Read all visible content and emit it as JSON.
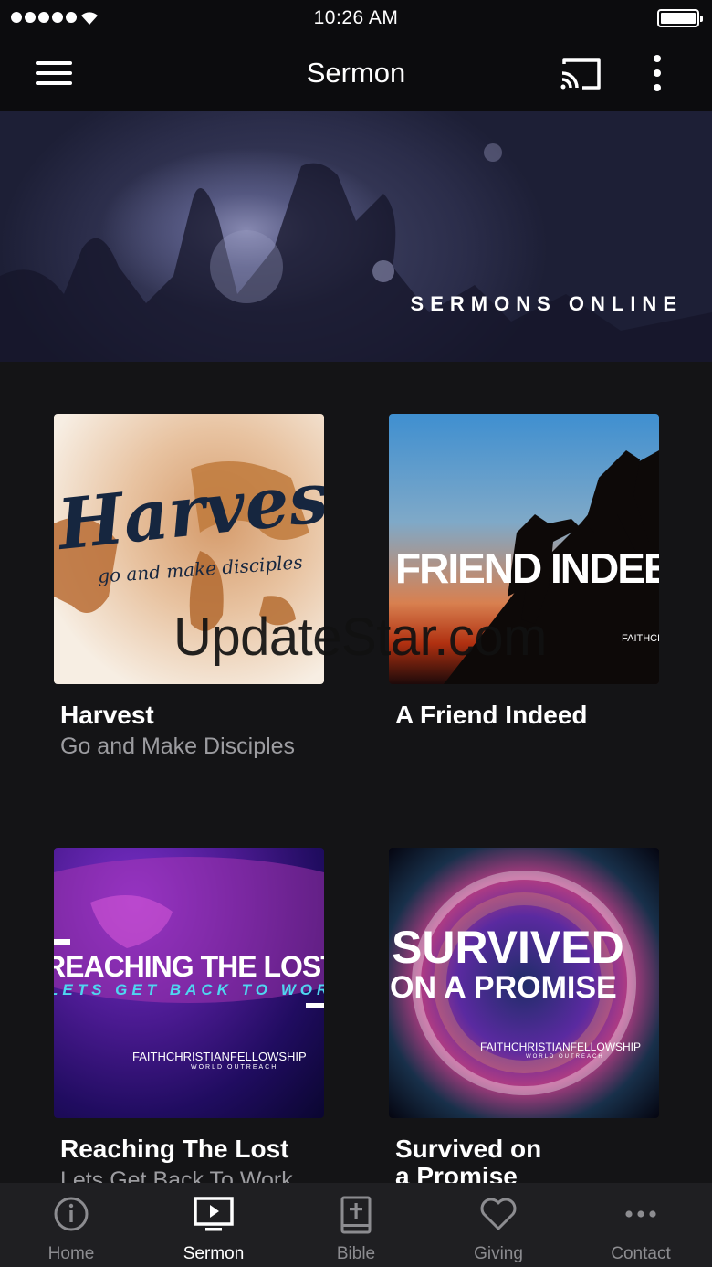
{
  "status_bar": {
    "time": "10:26 AM",
    "signal_bars": 5,
    "wifi_icon": "wifi-icon",
    "battery_icon": "battery-icon"
  },
  "app_bar": {
    "title": "Sermon",
    "menu_icon": "hamburger-menu-icon",
    "cast_icon": "cast-icon",
    "more_icon": "more-vertical-icon"
  },
  "banner": {
    "text": "SERMONS ONLINE"
  },
  "sermons": [
    {
      "title": "Harvest",
      "subtitle": "Go and Make Disciples",
      "art": {
        "headline": "Harvest",
        "tagline": "go and make disciples"
      }
    },
    {
      "title": "A Friend Indeed",
      "subtitle": "",
      "art": {
        "headline": "FRIEND INDEE",
        "logo": "FAITHCH"
      }
    },
    {
      "title": "Reaching The Lost",
      "subtitle": "Lets Get Back To Work",
      "art": {
        "headline": "REACHING THE LOST",
        "tagline": "LETS GET BACK TO WOR",
        "logo": "FAITHCHRISTIANFELLOWSHIP",
        "logo_sub": "WORLD OUTREACH"
      }
    },
    {
      "title": "Survived on",
      "title_line2": "a Promise",
      "subtitle": "",
      "art": {
        "headline": "SURVIVED",
        "headline2": "ON A PROMISE",
        "logo": "FAITHCHRISTIANFELLOWSHIP",
        "logo_sub": "WORLD OUTREACH"
      }
    }
  ],
  "watermark": "UpdateStar.com",
  "tab_bar": {
    "tabs": [
      {
        "label": "Home",
        "icon": "info-circle-icon"
      },
      {
        "label": "Sermon",
        "icon": "tv-play-icon",
        "active": true
      },
      {
        "label": "Bible",
        "icon": "bible-icon"
      },
      {
        "label": "Giving",
        "icon": "heart-icon"
      },
      {
        "label": "Contact",
        "icon": "more-horizontal-icon"
      }
    ]
  },
  "colors": {
    "background": "#141416",
    "bar": "#0c0c0e",
    "tab_bar": "#1f1f22",
    "inactive_tab": "#8c8c90",
    "subtitle": "#9c9ca0"
  }
}
